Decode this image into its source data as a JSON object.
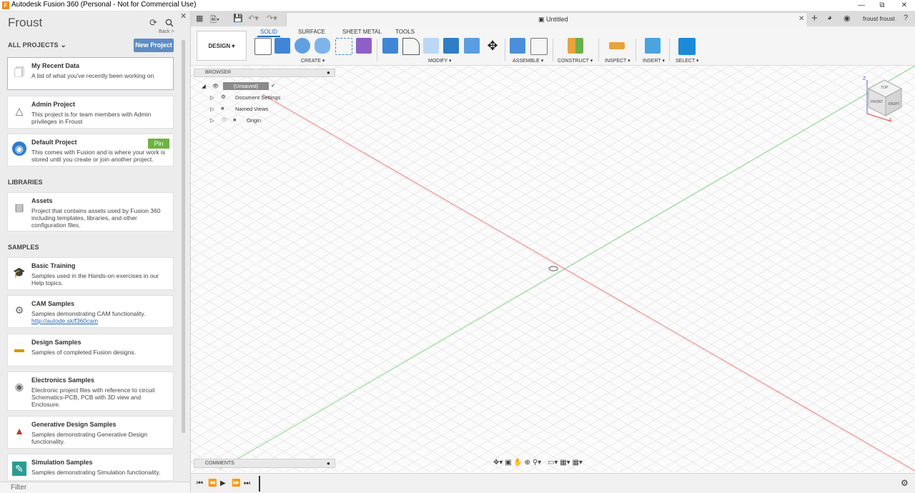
{
  "window": {
    "title": "Autodesk Fusion 360 (Personal - Not for Commercial Use)",
    "app_glyph": "F"
  },
  "panel": {
    "title": "Froust",
    "back": "Back >",
    "all_projects": "ALL PROJECTS",
    "new_project": "New Project",
    "filter": "Filter",
    "sections": {
      "libraries": "LIBRARIES",
      "samples": "SAMPLES"
    },
    "projects": [
      {
        "title": "My Recent Data",
        "desc": "A list of what you've recently been working on"
      },
      {
        "title": "Admin Project",
        "desc": "This project is for team members with Admin privileges in Froust"
      },
      {
        "title": "Default Project",
        "desc": "This comes with Fusion and is where your work is stored until you create or join another project.",
        "pin": "Pin"
      }
    ],
    "libraries": [
      {
        "title": "Assets",
        "desc": "Project that contains assets used by Fusion 360 including templates, libraries, and other configuration files."
      }
    ],
    "samples": [
      {
        "title": "Basic Training",
        "desc": "Samples used in the Hands-on exercises in our Help topics."
      },
      {
        "title": "CAM Samples",
        "desc": "Samples demonstrating CAM functionality.",
        "link": "http://autode.sk/f360cam"
      },
      {
        "title": "Design Samples",
        "desc": "Samples of completed Fusion designs."
      },
      {
        "title": "Electronics Samples",
        "desc": "Electronic project files with reference to circuit Schematics-PCB, PCB with 3D view and Enclosure."
      },
      {
        "title": "Generative Design Samples",
        "desc": "Samples demonstrating Generative Design functionality."
      },
      {
        "title": "Simulation Samples",
        "desc": "Samples demonstrating Simulation functionality."
      }
    ]
  },
  "document": {
    "tab_title": "Untitled",
    "user": "froust froust"
  },
  "ribbon": {
    "workspace": "DESIGN",
    "tabs": [
      "SOLID",
      "SURFACE",
      "SHEET METAL",
      "TOOLS"
    ],
    "groups": [
      "CREATE",
      "MODIFY",
      "ASSEMBLE",
      "CONSTRUCT",
      "INSPECT",
      "INSERT",
      "SELECT"
    ]
  },
  "browser": {
    "label": "BROWSER",
    "root": "(Unsaved)",
    "items": [
      "Document Settings",
      "Named Views",
      "Origin"
    ]
  },
  "comments": {
    "label": "COMMENTS"
  },
  "viewcube": {
    "top": "TOP",
    "front": "FRONT",
    "right": "RIGHT",
    "z": "Z",
    "x": "X"
  },
  "colors": {
    "accent": "#1b6bbd",
    "new_project": "#5e8cc4",
    "pin": "#6db33f",
    "x_axis": "#e04848",
    "y_axis": "#5cc85c"
  }
}
